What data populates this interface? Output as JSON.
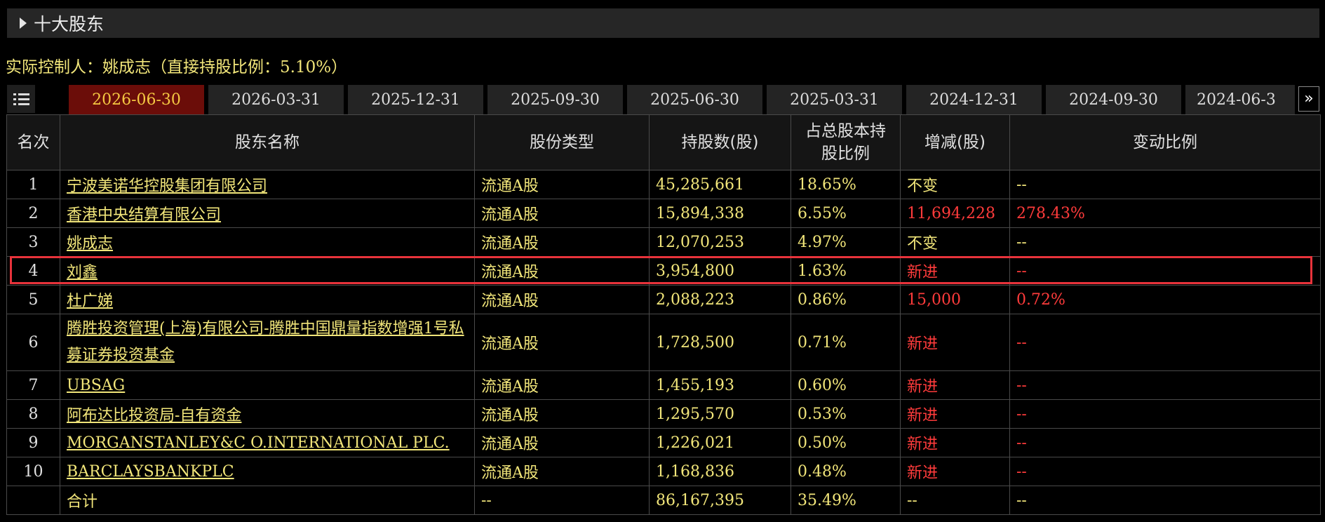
{
  "section": {
    "title": "十大股东",
    "icon": "caret-right-icon"
  },
  "controller": "实际控制人：姚成志（直接持股比例：5.10%）",
  "tabs": [
    {
      "label": "2026-06-30",
      "active": true
    },
    {
      "label": "2026-03-31"
    },
    {
      "label": "2025-12-31"
    },
    {
      "label": "2025-09-30"
    },
    {
      "label": "2025-06-30"
    },
    {
      "label": "2025-03-31"
    },
    {
      "label": "2024-12-31"
    },
    {
      "label": "2024-09-30"
    },
    {
      "label": "2024-06-3"
    }
  ],
  "columns": [
    "名次",
    "股东名称",
    "股份类型",
    "持股数(股)",
    "占总股本持股比例",
    "增减(股)",
    "变动比例"
  ],
  "rows": [
    {
      "rank": "1",
      "name": "宁波美诺华控股集团有限公司",
      "type": "流通A股",
      "shares": "45,285,661",
      "ratio": "18.65%",
      "change": "不变",
      "change_ratio": "--",
      "change_color": "yellow"
    },
    {
      "rank": "2",
      "name": "香港中央结算有限公司",
      "type": "流通A股",
      "shares": "15,894,338",
      "ratio": "6.55%",
      "change": "11,694,228",
      "change_ratio": "278.43%",
      "change_color": "red"
    },
    {
      "rank": "3",
      "name": "姚成志",
      "type": "流通A股",
      "shares": "12,070,253",
      "ratio": "4.97%",
      "change": "不变",
      "change_ratio": "--",
      "change_color": "yellow"
    },
    {
      "rank": "4",
      "name": "刘鑫",
      "type": "流通A股",
      "shares": "3,954,800",
      "ratio": "1.63%",
      "change": "新进",
      "change_ratio": "--",
      "change_color": "red"
    },
    {
      "rank": "5",
      "name": "杜广娣",
      "type": "流通A股",
      "shares": "2,088,223",
      "ratio": "0.86%",
      "change": "15,000",
      "change_ratio": "0.72%",
      "change_color": "red"
    },
    {
      "rank": "6",
      "name": "腾胜投资管理(上海)有限公司-腾胜中国鼎量指数增强1号私募证券投资基金",
      "type": "流通A股",
      "shares": "1,728,500",
      "ratio": "0.71%",
      "change": "新进",
      "change_ratio": "--",
      "change_color": "red"
    },
    {
      "rank": "7",
      "name": "UBSAG",
      "type": "流通A股",
      "shares": "1,455,193",
      "ratio": "0.60%",
      "change": "新进",
      "change_ratio": "--",
      "change_color": "red"
    },
    {
      "rank": "8",
      "name": "阿布达比投资局-自有资金",
      "type": "流通A股",
      "shares": "1,295,570",
      "ratio": "0.53%",
      "change": "新进",
      "change_ratio": "--",
      "change_color": "red"
    },
    {
      "rank": "9",
      "name": "MORGANSTANLEY&C O.INTERNATIONAL PLC.",
      "type": "流通A股",
      "shares": "1,226,021",
      "ratio": "0.50%",
      "change": "新进",
      "change_ratio": "--",
      "change_color": "red"
    },
    {
      "rank": "10",
      "name": "BARCLAYSBANKPLC",
      "type": "流通A股",
      "shares": "1,168,836",
      "ratio": "0.48%",
      "change": "新进",
      "change_ratio": "--",
      "change_color": "red"
    }
  ],
  "total": {
    "label": "合计",
    "type": "--",
    "shares": "86,167,395",
    "ratio": "35.49%",
    "change": "--",
    "change_ratio": "--"
  },
  "colors": {
    "text_yellow": "#f2e67a",
    "text_red": "#ff3b3b",
    "active_tab_bg": "#6b0d09",
    "highlight_border": "#e8333b"
  },
  "icons": {
    "menu": "list-menu-icon",
    "next": "double-chevron-right-icon"
  }
}
